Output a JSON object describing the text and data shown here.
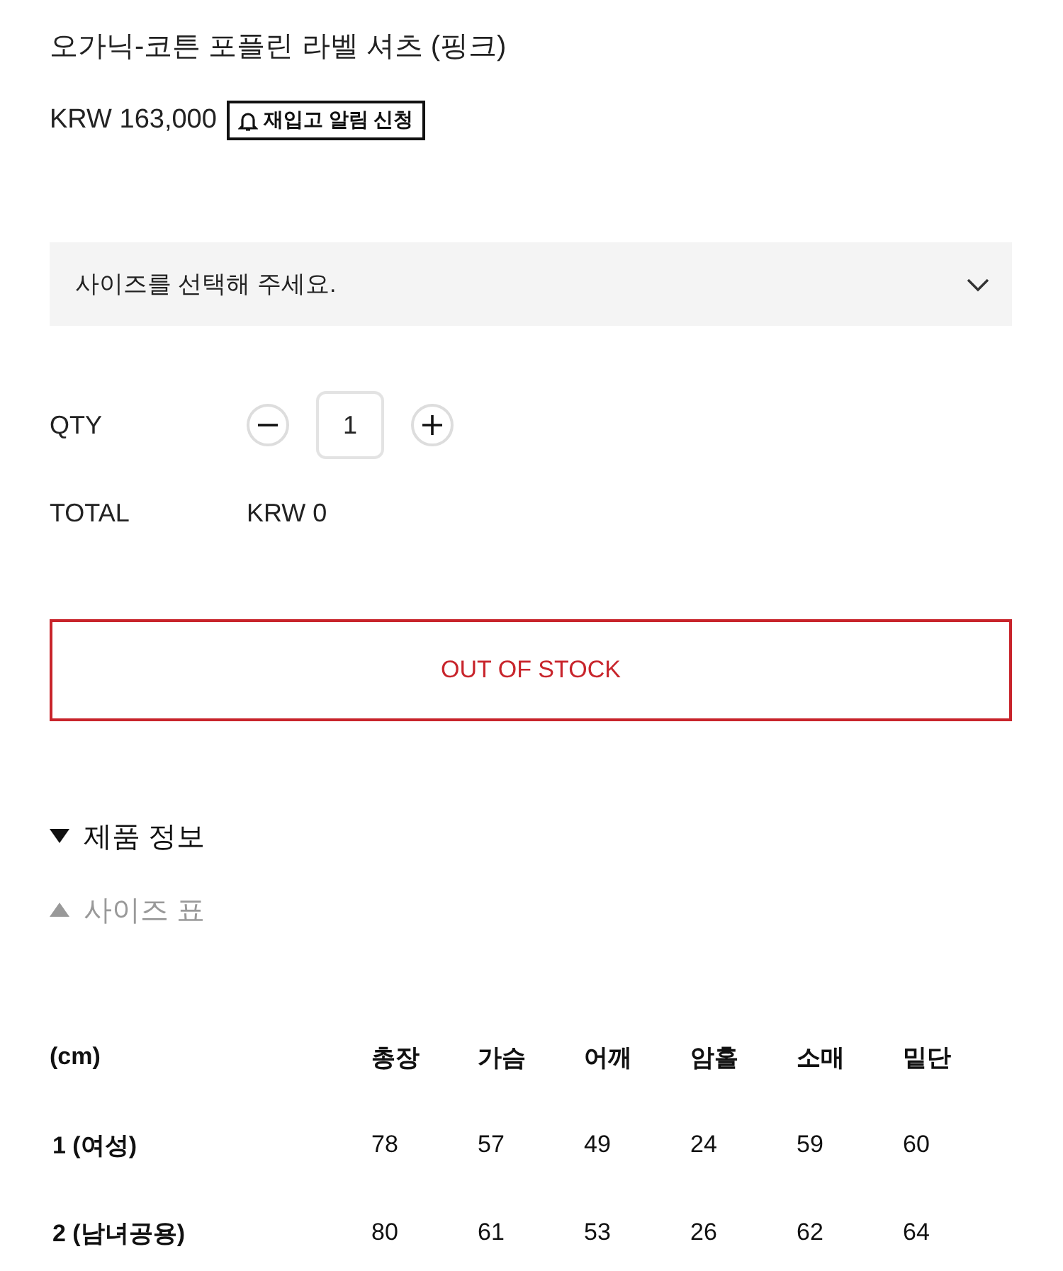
{
  "product": {
    "title": "오가닉-코튼 포플린 라벨 셔츠 (핑크)",
    "price": "KRW 163,000",
    "restock_button": "재입고 알림 신청"
  },
  "size_select": {
    "placeholder": "사이즈를 선택해 주세요."
  },
  "quantity": {
    "label": "QTY",
    "value": "1"
  },
  "total": {
    "label": "TOTAL",
    "value": "KRW 0"
  },
  "stock_button": {
    "label": "OUT OF STOCK",
    "disabled": true
  },
  "sections": [
    {
      "label": "제품 정보",
      "expanded": false
    },
    {
      "label": "사이즈 표",
      "expanded": true
    }
  ],
  "size_table": {
    "columns": [
      "(cm)",
      "총장",
      "가슴",
      "어깨",
      "암홀",
      "소매",
      "밑단"
    ],
    "rows": [
      [
        "1 (여성)",
        "78",
        "57",
        "49",
        "24",
        "59",
        "60"
      ],
      [
        "2 (남녀공용)",
        "80",
        "61",
        "53",
        "26",
        "62",
        "64"
      ]
    ]
  }
}
